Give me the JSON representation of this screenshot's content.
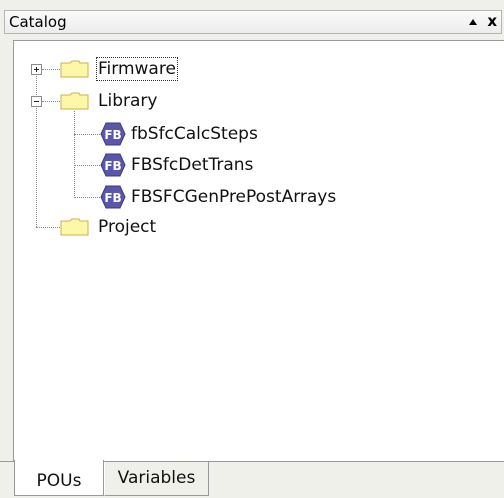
{
  "panel": {
    "title": "Catalog",
    "pin_glyph": "▲",
    "close_glyph": "x"
  },
  "tree": {
    "firmware": {
      "label": "Firmware",
      "icon": "folder-icon",
      "expander": "plus"
    },
    "library": {
      "label": "Library",
      "icon": "folder-icon",
      "expander": "minus",
      "children": [
        {
          "label": "fbSfcCalcSteps",
          "icon": "function-block-icon",
          "icon_text": "FB"
        },
        {
          "label": "FBSfcDetTrans",
          "icon": "function-block-icon",
          "icon_text": "FB"
        },
        {
          "label": "FBSFCGenPrePostArrays",
          "icon": "function-block-icon",
          "icon_text": "FB"
        }
      ]
    },
    "project": {
      "label": "Project",
      "icon": "folder-icon"
    }
  },
  "tabs": [
    {
      "label": "POUs",
      "active": true
    },
    {
      "label": "Variables",
      "active": false
    }
  ],
  "colors": {
    "folder_fill": "#fdf7a8",
    "folder_stroke": "#c8b24a",
    "fb_fill": "#5b57a8",
    "panel_bg": "#f0f0ea"
  }
}
